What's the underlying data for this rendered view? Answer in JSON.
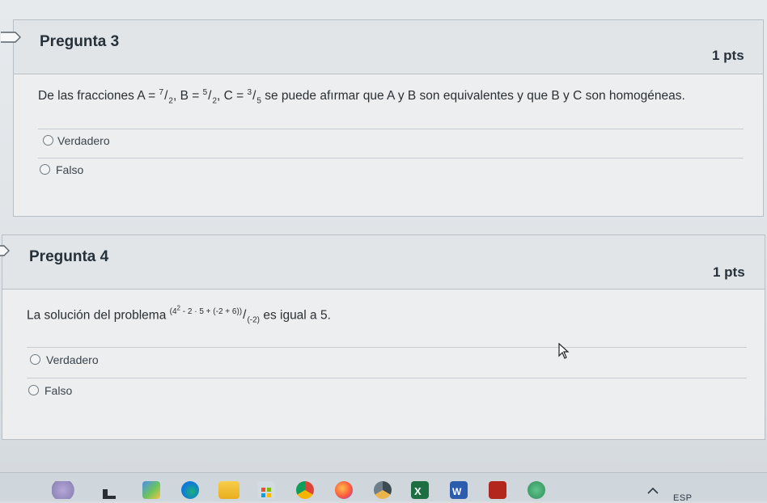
{
  "questions": [
    {
      "title": "Pregunta 3",
      "points": "1 pts",
      "text_prefix": "De las fracciones ",
      "fractions": [
        {
          "label": "A =",
          "num": "7",
          "den": "2"
        },
        {
          "label": "B =",
          "num": "5",
          "den": "2"
        },
        {
          "label": "C =",
          "num": "3",
          "den": "5"
        }
      ],
      "text_suffix": " se puede afırmar que A y B son equivalentes y que B y C son homogéneas.",
      "answers": [
        "Verdadero",
        "Falso"
      ]
    },
    {
      "title": "Pregunta 4",
      "points": "1 pts",
      "text_prefix": "La solución del problema ",
      "expr_num_open": "(4",
      "expr_exp": "2",
      "expr_num_rest": " - 2 · 5 + (-2 + 6))",
      "expr_den": "(-2)",
      "text_suffix": " es igual a 5.",
      "answers": [
        "Verdadero",
        "Falso"
      ]
    }
  ],
  "taskbar": {
    "language": "ESP",
    "icons": [
      "weather-icon",
      "widgets-icon",
      "teams-icon",
      "edge-icon",
      "file-explorer-icon",
      "store-icon",
      "chrome-icon",
      "firefox-icon",
      "chrome-canary-icon",
      "excel-icon",
      "word-icon",
      "acrobat-icon",
      "app-icon",
      "chevron-icon"
    ]
  },
  "colors": {
    "card_bg": "#eceef0",
    "header_bg": "#e1e5e8",
    "border": "#b9c0c5",
    "text": "#2a2f33",
    "taskbar": "#cfd6dc"
  }
}
